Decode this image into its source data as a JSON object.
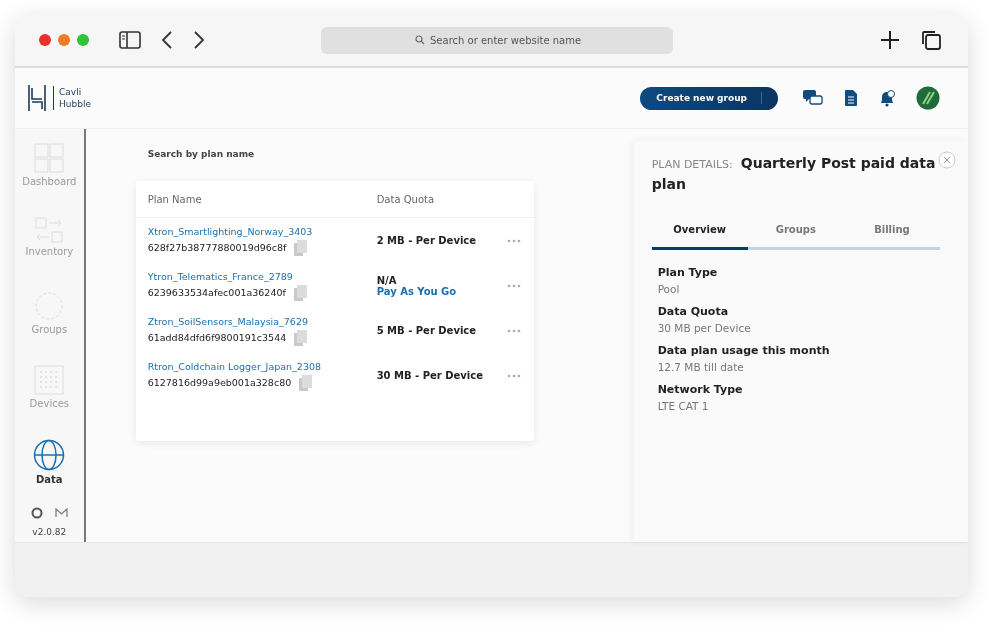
{
  "browser": {
    "address_placeholder": "Search or enter website name"
  },
  "brand": {
    "line1": "Cavli",
    "line2": "Hubble"
  },
  "header": {
    "create_button": "Create new group"
  },
  "sidebar": {
    "items": [
      {
        "label": "Dashboard",
        "kind": "dashboard",
        "selected": false
      },
      {
        "label": "Inventory",
        "kind": "inventory",
        "selected": false
      },
      {
        "label": "Groups",
        "kind": "groups",
        "selected": false
      },
      {
        "label": "Devices",
        "kind": "devices",
        "selected": false
      },
      {
        "label": "Data",
        "kind": "data",
        "selected": true
      }
    ],
    "version": "v2.0.82"
  },
  "search_label": "Search by plan name",
  "table": {
    "columns": [
      "Plan Name",
      "Data Quota"
    ],
    "rows": [
      {
        "name": "Xtron_Smartlighting_Norway_3403",
        "id": "628f27b38777880019d96c8f",
        "quota": "2 MB - Per Device"
      },
      {
        "name": "Ytron_Telematics_France_2789",
        "id": "6239633534afec001a36240f",
        "quota": "N/A",
        "quota_note": "Pay As You Go"
      },
      {
        "name": "Ztron_SoilSensors_Malaysia_7629",
        "id": "61add84dfd6f9800191c3544",
        "quota": "5 MB - Per Device"
      },
      {
        "name": "Rtron_Coldchain Logger_Japan_2308",
        "id": "6127816d99a9eb001a328c80",
        "quota": "30 MB - Per Device"
      }
    ]
  },
  "details": {
    "label": "PLAN DETAILS:",
    "title": "Quarterly Post paid data plan",
    "tabs": [
      {
        "label": "Overview",
        "selected": true
      },
      {
        "label": "Groups",
        "selected": false
      },
      {
        "label": "Billing",
        "selected": false
      }
    ],
    "fields": [
      {
        "label": "Plan Type",
        "value": "Pool"
      },
      {
        "label": "Data Quota",
        "value": "30 MB per Device"
      },
      {
        "label": "Data plan usage this month",
        "value": "12.7 MB till date"
      },
      {
        "label": "Network Type",
        "value": "LTE CAT 1"
      }
    ]
  }
}
